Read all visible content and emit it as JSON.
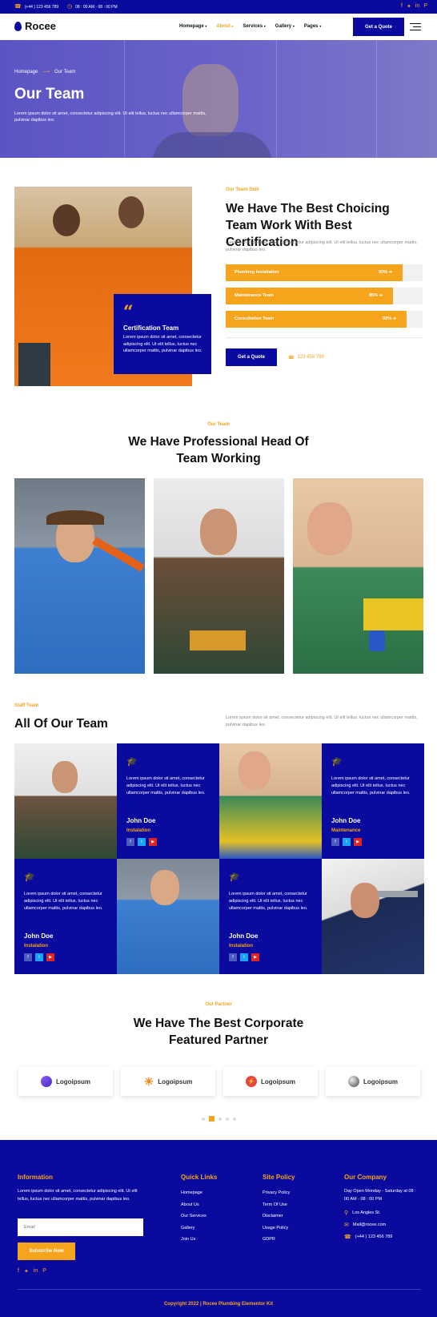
{
  "topbar": {
    "phone": "(+44 ) 123 456 789",
    "hours": "08 : 00 AM - 08 : 00 PM"
  },
  "header": {
    "logo": "Rocee",
    "nav": [
      "Homepage",
      "About",
      "Services",
      "Gallery",
      "Pages"
    ],
    "active_nav": "About",
    "cta": "Get a Quote"
  },
  "hero": {
    "breadcrumb_home": "Homepage",
    "breadcrumb_current": "Our Team",
    "title": "Our Team",
    "text": "Lorem ipsum dolor sit amet, consectetur adipiscing elit. Ut elit tellus, luctus nec ullamcorper mattis, pulvinar dapibus leo."
  },
  "skills": {
    "eyebrow": "Our Team Skill",
    "title": "We Have The Best Choicing Team Work With Best Certification",
    "text": "Lorem ipsum dolor sit amet, consectetur adipiscing elit. Ut elit tellus, luctus nec ullamcorper mattis, pulvinar dapibus leo.",
    "cert_title": "Certification Team",
    "cert_text": "Lorem ipsum dolor sit amet, consectetur adipiscing elit. Ut elit tellus, luctus nec ullamcorper mattis, pulvinar dapibus leo.",
    "bars": [
      {
        "label": "Plumbing Installation",
        "pct_text": "90%",
        "value": 0.9
      },
      {
        "label": "Maintenance Team",
        "pct_text": "85%",
        "value": 0.85
      },
      {
        "label": "Consultation Team",
        "pct_text": "92%",
        "value": 0.92
      }
    ],
    "cta": "Get a Quote",
    "phone": "123 456 789"
  },
  "head_team": {
    "eyebrow": "Our Team",
    "title_line1": "We Have Professional Head Of",
    "title_line2": "Team Working"
  },
  "staff": {
    "eyebrow": "Staff Team",
    "title": "All Of Our Team",
    "text": "Lorem ipsum dolor sit amet, consectetur adipiscing elit. Ut elit tellus, luctus nec ullamcorper mattis, pulvinar dapibus leo.",
    "cards": [
      {
        "text": "Lorem ipsum dolor sit amet, consectetur adipiscing elit. Ut elit tellus, luctus nec ullamcorper mattis, pulvinar dapibus leo.",
        "name": "John Doe",
        "role": "Instalation"
      },
      {
        "text": "Lorem ipsum dolor sit amet, consectetur adipiscing elit. Ut elit tellus, luctus nec ullamcorper mattis, pulvinar dapibus leo.",
        "name": "John Doe",
        "role": "Maintenance"
      },
      {
        "text": "Lorem ipsum dolor sit amet, consectetur adipiscing elit. Ut elit tellus, luctus nec ullamcorper mattis, pulvinar dapibus leo.",
        "name": "John Doe",
        "role": "Instalation"
      },
      {
        "text": "Lorem ipsum dolor sit amet, consectetur adipiscing elit. Ut elit tellus, luctus nec ullamcorper mattis, pulvinar dapibus leo.",
        "name": "John Doe",
        "role": "Instalation"
      }
    ]
  },
  "partners": {
    "eyebrow": "Our Partner",
    "title_line1": "We Have The Best Corporate",
    "title_line2": "Featured Partner",
    "logos": [
      "Logoipsum",
      "Logoipsum",
      "Logoipsum",
      "Logoipsum"
    ]
  },
  "footer": {
    "info_title": "Information",
    "info_text": "Lorem ipsum dolor sit amet, consectetur adipiscing elit. Ut elit tellus, luctus nec ullamcorper mattis, pulvinar dapibus leo.",
    "email_placeholder": "Email",
    "subscribe": "Subscribe Now",
    "quick_title": "Quick Links",
    "quick_links": [
      "Homepage",
      "About Us",
      "Our Services",
      "Gallery",
      "Join Us"
    ],
    "policy_title": "Site Policy",
    "policy_links": [
      "Privacy Policy",
      "Term Of Use",
      "Disclaimer",
      "Usage Policy",
      "GDPR"
    ],
    "company_title": "Our Company",
    "company_hours": "Day Open Monday - Saturday at 08 : 00 AM - 08 : 00 PM",
    "address": "Los Angles St.",
    "email": "Mail@rocee.com",
    "phone": "(+44 ) 123 456 789",
    "copyright": "Copyright 2022 | Rocee Plumbing Elementor Kit"
  },
  "colors": {
    "brand": "#0a0a9e",
    "accent": "#f7a41d"
  }
}
